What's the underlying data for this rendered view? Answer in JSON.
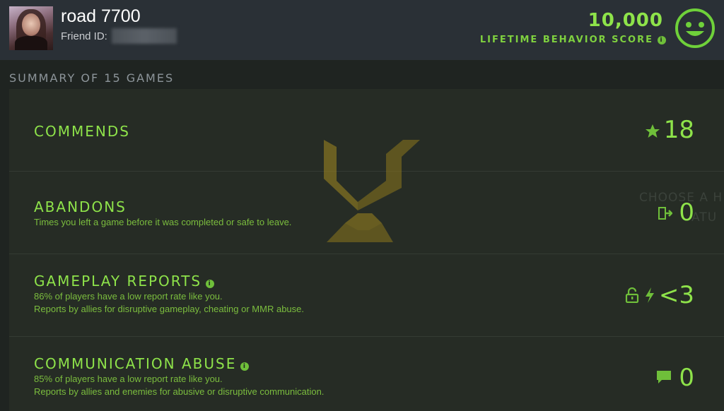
{
  "header": {
    "username": "road 7700",
    "friend_label": "Friend ID:",
    "score": "10,000",
    "score_label": "LIFETIME BEHAVIOR SCORE",
    "info_glyph": "i",
    "avatar": "user-avatar",
    "mood_icon": "smiley-face-icon"
  },
  "summary": {
    "title": "SUMMARY OF 15 GAMES"
  },
  "rows": [
    {
      "title": "COMMENDS",
      "value": "18",
      "icon": "star-thumb-icon"
    },
    {
      "title": "ABANDONS",
      "desc": "Times you left a game before it was completed or safe to leave.",
      "value": "0",
      "icon": "exit-door-icon"
    },
    {
      "title": "GAMEPLAY REPORTS",
      "desc1": "86% of players have a low report rate like you.",
      "desc2": "Reports by allies for disruptive gameplay, cheating or MMR abuse.",
      "value": "<3",
      "icons": [
        "unlock-icon",
        "lightning-icon"
      ]
    },
    {
      "title": "COMMUNICATION ABUSE",
      "desc1": "85% of players have a low report rate like you.",
      "desc2": "Reports by allies and enemies for abusive or disruptive communication.",
      "value": "0",
      "icon": "chat-bubble-icon"
    }
  ],
  "background_text": {
    "line1": "CHOOSE A H",
    "line2": "ATU"
  },
  "colors": {
    "accent": "#8ee34a",
    "header_bg": "#2a3036",
    "panel_bg": "#242a23"
  }
}
